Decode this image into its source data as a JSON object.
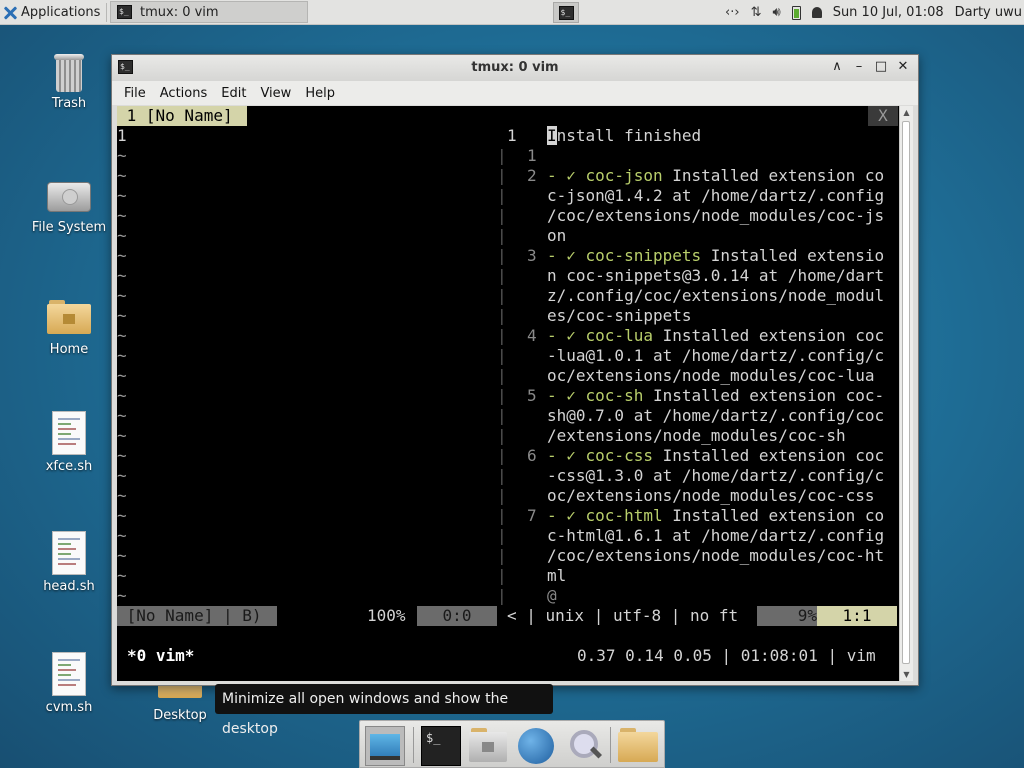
{
  "top_panel": {
    "applications_label": "Applications",
    "task_title": "tmux: 0 vim",
    "clock": "Sun 10 Jul, 01:08",
    "user": "Darty uwu",
    "tray_icons": [
      "network-icon",
      "updates-icon",
      "volume-icon",
      "battery-icon",
      "notification-bell-icon"
    ]
  },
  "desktop": {
    "icons": [
      {
        "label": "Trash",
        "icon": "trash-icon"
      },
      {
        "label": "File System",
        "icon": "drive-icon"
      },
      {
        "label": "Home",
        "icon": "home-folder-icon"
      },
      {
        "label": "xfce.sh",
        "icon": "script-file-icon"
      },
      {
        "label": "head.sh",
        "icon": "script-file-icon"
      },
      {
        "label": "cvm.sh",
        "icon": "script-file-icon"
      },
      {
        "label": "Desktop",
        "icon": "folder-icon"
      }
    ]
  },
  "window": {
    "title": "tmux: 0 vim",
    "menu": [
      "File",
      "Actions",
      "Edit",
      "View",
      "Help"
    ]
  },
  "vim": {
    "tabline_left": " 1 [No Name] ",
    "tabline_close": "X",
    "left_line_number": "1",
    "right_header_num": "1",
    "right_header_first_char": "I",
    "right_header_rest": "nstall finished",
    "rows": [
      {
        "num": "1",
        "prefix": "",
        "name": "",
        "text": ""
      },
      {
        "num": "2",
        "prefix": "- ✓ ",
        "name": "coc-json",
        "text": " Installed extension co"
      },
      {
        "num": "",
        "prefix": "",
        "name": "",
        "text": "c-json@1.4.2 at /home/dartz/.config"
      },
      {
        "num": "",
        "prefix": "",
        "name": "",
        "text": "/coc/extensions/node_modules/coc-js"
      },
      {
        "num": "",
        "prefix": "",
        "name": "",
        "text": "on"
      },
      {
        "num": "3",
        "prefix": "- ✓ ",
        "name": "coc-snippets",
        "text": " Installed extensio"
      },
      {
        "num": "",
        "prefix": "",
        "name": "",
        "text": "n coc-snippets@3.0.14 at /home/dart"
      },
      {
        "num": "",
        "prefix": "",
        "name": "",
        "text": "z/.config/coc/extensions/node_modul"
      },
      {
        "num": "",
        "prefix": "",
        "name": "",
        "text": "es/coc-snippets"
      },
      {
        "num": "4",
        "prefix": "- ✓ ",
        "name": "coc-lua",
        "text": " Installed extension coc"
      },
      {
        "num": "",
        "prefix": "",
        "name": "",
        "text": "-lua@1.0.1 at /home/dartz/.config/c"
      },
      {
        "num": "",
        "prefix": "",
        "name": "",
        "text": "oc/extensions/node_modules/coc-lua"
      },
      {
        "num": "5",
        "prefix": "- ✓ ",
        "name": "coc-sh",
        "text": " Installed extension coc-"
      },
      {
        "num": "",
        "prefix": "",
        "name": "",
        "text": "sh@0.7.0 at /home/dartz/.config/coc"
      },
      {
        "num": "",
        "prefix": "",
        "name": "",
        "text": "/extensions/node_modules/coc-sh"
      },
      {
        "num": "6",
        "prefix": "- ✓ ",
        "name": "coc-css",
        "text": " Installed extension coc"
      },
      {
        "num": "",
        "prefix": "",
        "name": "",
        "text": "-css@1.3.0 at /home/dartz/.config/c"
      },
      {
        "num": "",
        "prefix": "",
        "name": "",
        "text": "oc/extensions/node_modules/coc-css"
      },
      {
        "num": "7",
        "prefix": "- ✓ ",
        "name": "coc-html",
        "text": " Installed extension co"
      },
      {
        "num": "",
        "prefix": "",
        "name": "",
        "text": "c-html@1.6.1 at /home/dartz/.config"
      },
      {
        "num": "",
        "prefix": "",
        "name": "",
        "text": "/coc/extensions/node_modules/coc-ht"
      },
      {
        "num": "",
        "prefix": "",
        "name": "",
        "text": "ml"
      },
      {
        "num": "",
        "prefix": "",
        "name": "",
        "text": "@"
      }
    ],
    "statusline": {
      "left": " [No Name] | B) ",
      "percent": "100%",
      "pos_left": "0:0",
      "mid": "< | unix | utf-8 | no ft",
      "scroll_pct": "9%",
      "pos_right": "1:1"
    },
    "tmux": {
      "window": "*0 vim*",
      "right": "0.37 0.14 0.05 | 01:08:01 | vim"
    }
  },
  "tooltip": "Minimize all open windows and show the desktop",
  "dock": {
    "items": [
      "show-desktop-icon",
      "terminal-icon",
      "home-folder-icon",
      "web-browser-icon",
      "search-icon",
      "files-folder-icon"
    ]
  },
  "colors": {
    "desktop_bg": "#2a86b4",
    "vim_accent": "#d4d4a9",
    "check_green": "#b8ce6b"
  }
}
